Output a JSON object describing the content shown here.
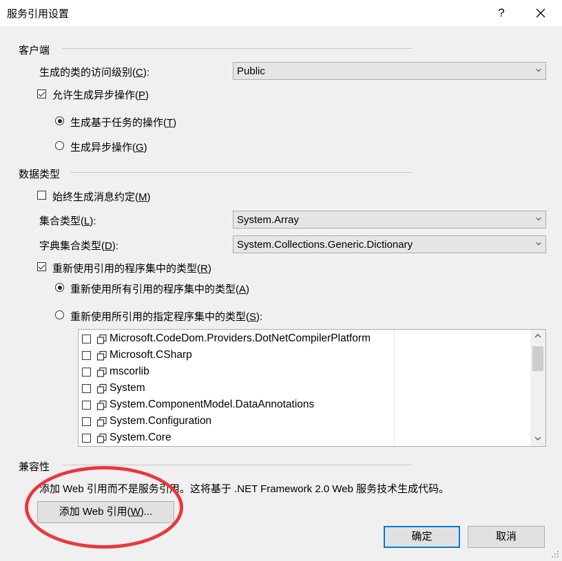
{
  "window": {
    "title": "服务引用设置",
    "help_label": "?",
    "close_label": "✕"
  },
  "client_group": {
    "label": "客户端",
    "access_level_label": "生成的类的访问级别(",
    "access_level_key": "C",
    "access_level_tail": "):",
    "access_level_value": "Public",
    "async_label": "允许生成异步操作(",
    "async_key": "P",
    "async_tail": ")",
    "async_checked": true,
    "task_based_label": "生成基于任务的操作(",
    "task_based_key": "T",
    "task_based_tail": ")",
    "task_based_selected": true,
    "async_ops_label": "生成异步操作(",
    "async_ops_key": "G",
    "async_ops_tail": ")",
    "async_ops_selected": false
  },
  "data_type_group": {
    "label": "数据类型",
    "always_msg_label": "始终生成消息约定(",
    "always_msg_key": "M",
    "always_msg_tail": ")",
    "always_msg_checked": false,
    "collection_label": "集合类型(",
    "collection_key": "L",
    "collection_tail": "):",
    "collection_value": "System.Array",
    "dictionary_label": "字典集合类型(",
    "dictionary_key": "D",
    "dictionary_tail": "):",
    "dictionary_value": "System.Collections.Generic.Dictionary",
    "reuse_label": "重新使用引用的程序集中的类型(",
    "reuse_key": "R",
    "reuse_tail": ")",
    "reuse_checked": true,
    "reuse_all_label": "重新使用所有引用的程序集中的类型(",
    "reuse_all_key": "A",
    "reuse_all_tail": ")",
    "reuse_all_selected": true,
    "reuse_specified_label": "重新使用所引用的指定程序集中的类型(",
    "reuse_specified_key": "S",
    "reuse_specified_tail": "):",
    "reuse_specified_selected": false,
    "assemblies": [
      "Microsoft.CodeDom.Providers.DotNetCompilerPlatform",
      "Microsoft.CSharp",
      "mscorlib",
      "System",
      "System.ComponentModel.DataAnnotations",
      "System.Configuration",
      "System.Core"
    ]
  },
  "compat_group": {
    "label": "兼容性",
    "description": "添加 Web 引用而不是服务引用。这将基于 .NET Framework 2.0 Web 服务技术生成代码。",
    "add_web_ref_label": "添加 Web 引用(",
    "add_web_ref_key": "W",
    "add_web_ref_tail": ")..."
  },
  "footer": {
    "ok_label": "确定",
    "cancel_label": "取消"
  },
  "colors": {
    "annotation": "#e8383d",
    "accent": "#0078d7"
  }
}
